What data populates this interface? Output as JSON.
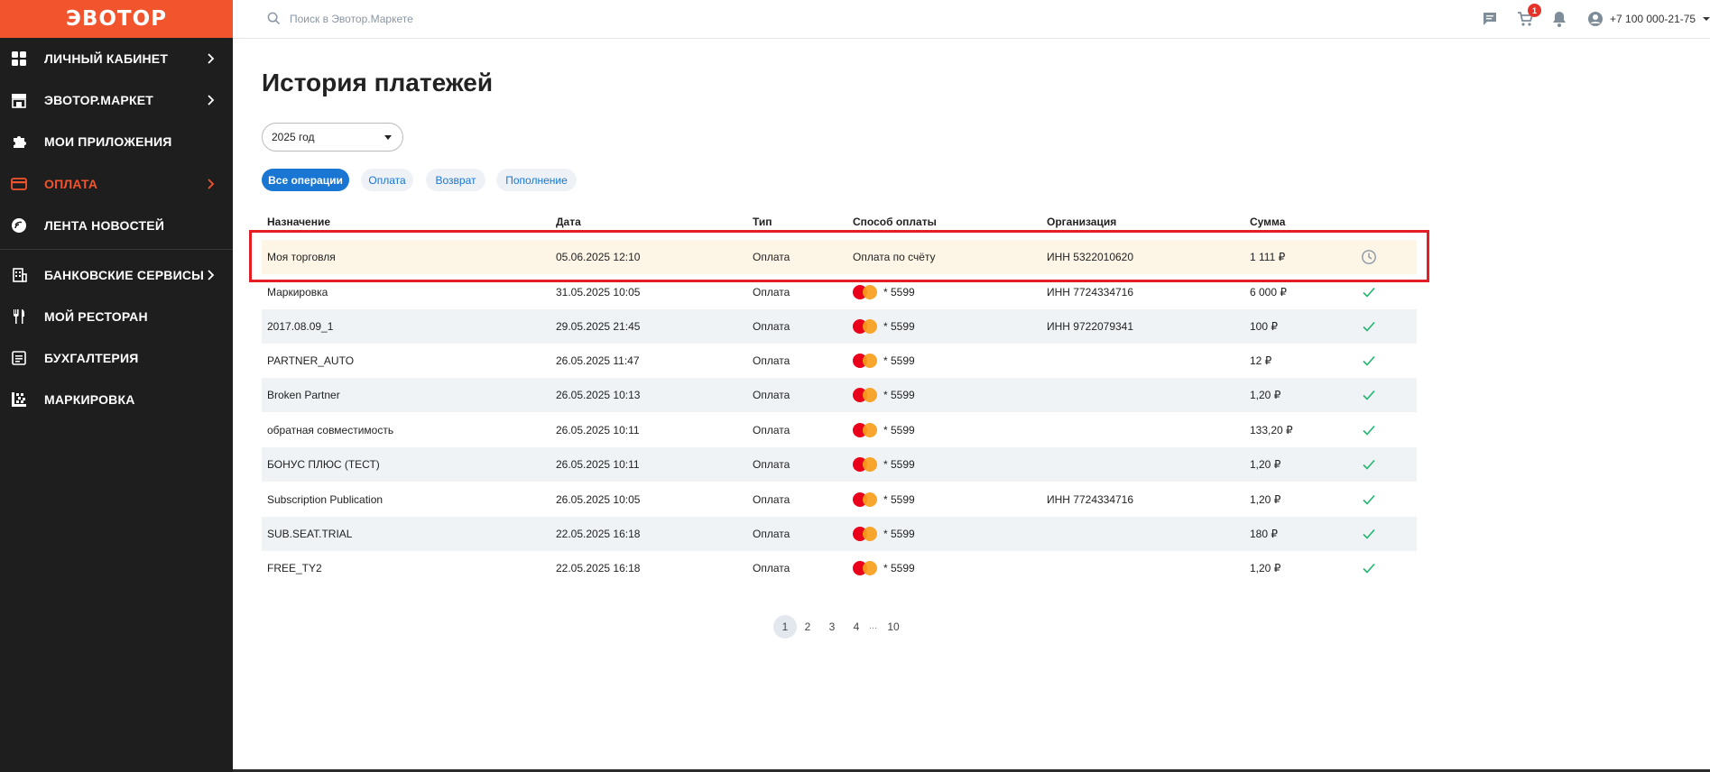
{
  "brand": {
    "logo_text": "ЭВОТОР",
    "accent": "#f2542d",
    "sidebar_bg": "#1e1e1e",
    "link_blue": "#1976d2"
  },
  "sidebar": {
    "items": [
      {
        "label": "ЛИЧНЫЙ КАБИНЕТ",
        "icon": "dashboard-grid-icon",
        "chevron": true,
        "active": false
      },
      {
        "label": "ЭВОТОР.МАРКЕТ",
        "icon": "store-icon",
        "chevron": true,
        "active": false
      },
      {
        "label": "МОИ ПРИЛОЖЕНИЯ",
        "icon": "puzzle-icon",
        "chevron": false,
        "active": false
      },
      {
        "label": "ОПЛАТА",
        "icon": "credit-card-icon",
        "chevron": true,
        "active": true
      },
      {
        "label": "ЛЕНТА НОВОСТЕЙ",
        "icon": "news-icon",
        "chevron": false,
        "active": false
      },
      {
        "label": "БАНКОВСКИЕ СЕРВИСЫ",
        "icon": "bank-icon",
        "chevron": true,
        "active": false
      },
      {
        "label": "МОЙ РЕСТОРАН",
        "icon": "fork-knife-icon",
        "chevron": false,
        "active": false
      },
      {
        "label": "БУХГАЛТЕРИЯ",
        "icon": "ledger-icon",
        "chevron": false,
        "active": false
      },
      {
        "label": "МАРКИРОВКА",
        "icon": "datamatrix-icon",
        "chevron": false,
        "active": false
      }
    ]
  },
  "header": {
    "search_placeholder": "Поиск в Эвотор.Маркете",
    "cart_count": "1",
    "phone": "+7 100 000-21-75",
    "icons": [
      "chat-icon",
      "cart-icon",
      "bell-icon",
      "user-icon"
    ]
  },
  "main": {
    "title": "История платежей",
    "year_filter": "2025 год",
    "chips": [
      "Все операции",
      "Оплата",
      "Возврат",
      "Пополнение"
    ],
    "columns": [
      "Назначение",
      "Дата",
      "Тип",
      "Способ оплаты",
      "Организация",
      "Сумма"
    ],
    "rows": [
      {
        "name": "Моя торговля",
        "date": "05.06.2025 12:10",
        "type": "Оплата",
        "method": "Оплата по счёту",
        "card": false,
        "org": "ИНН 5322010620",
        "sum": "1 111 ₽",
        "status": "pending"
      },
      {
        "name": "Маркировка",
        "date": "31.05.2025 10:05",
        "type": "Оплата",
        "method": "* 5599",
        "card": true,
        "org": "ИНН 7724334716",
        "sum": "6 000 ₽",
        "status": "done"
      },
      {
        "name": "2017.08.09_1",
        "date": "29.05.2025 21:45",
        "type": "Оплата",
        "method": "* 5599",
        "card": true,
        "org": "ИНН 9722079341",
        "sum": "100 ₽",
        "status": "done"
      },
      {
        "name": "PARTNER_AUTO",
        "date": "26.05.2025 11:47",
        "type": "Оплата",
        "method": "* 5599",
        "card": true,
        "org": "",
        "sum": "12 ₽",
        "status": "done"
      },
      {
        "name": "Broken Partner",
        "date": "26.05.2025 10:13",
        "type": "Оплата",
        "method": "* 5599",
        "card": true,
        "org": "",
        "sum": "1,20 ₽",
        "status": "done"
      },
      {
        "name": "обратная совместимость",
        "date": "26.05.2025 10:11",
        "type": "Оплата",
        "method": "* 5599",
        "card": true,
        "org": "",
        "sum": "133,20 ₽",
        "status": "done"
      },
      {
        "name": "БОНУС ПЛЮС (ТЕСТ)",
        "date": "26.05.2025 10:11",
        "type": "Оплата",
        "method": "* 5599",
        "card": true,
        "org": "",
        "sum": "1,20 ₽",
        "status": "done"
      },
      {
        "name": "Subscription Publication",
        "date": "26.05.2025 10:05",
        "type": "Оплата",
        "method": "* 5599",
        "card": true,
        "org": "ИНН 7724334716",
        "sum": "1,20 ₽",
        "status": "done"
      },
      {
        "name": "SUB.SEAT.TRIAL",
        "date": "22.05.2025 16:18",
        "type": "Оплата",
        "method": "* 5599",
        "card": true,
        "org": "",
        "sum": "180 ₽",
        "status": "done"
      },
      {
        "name": "FREE_TY2",
        "date": "22.05.2025 16:18",
        "type": "Оплата",
        "method": "* 5599",
        "card": true,
        "org": "",
        "sum": "1,20 ₽",
        "status": "done"
      }
    ],
    "pagination": {
      "pages": [
        "1",
        "2",
        "3",
        "4"
      ],
      "ellipsis": "...",
      "last": "10",
      "current": "1"
    }
  }
}
